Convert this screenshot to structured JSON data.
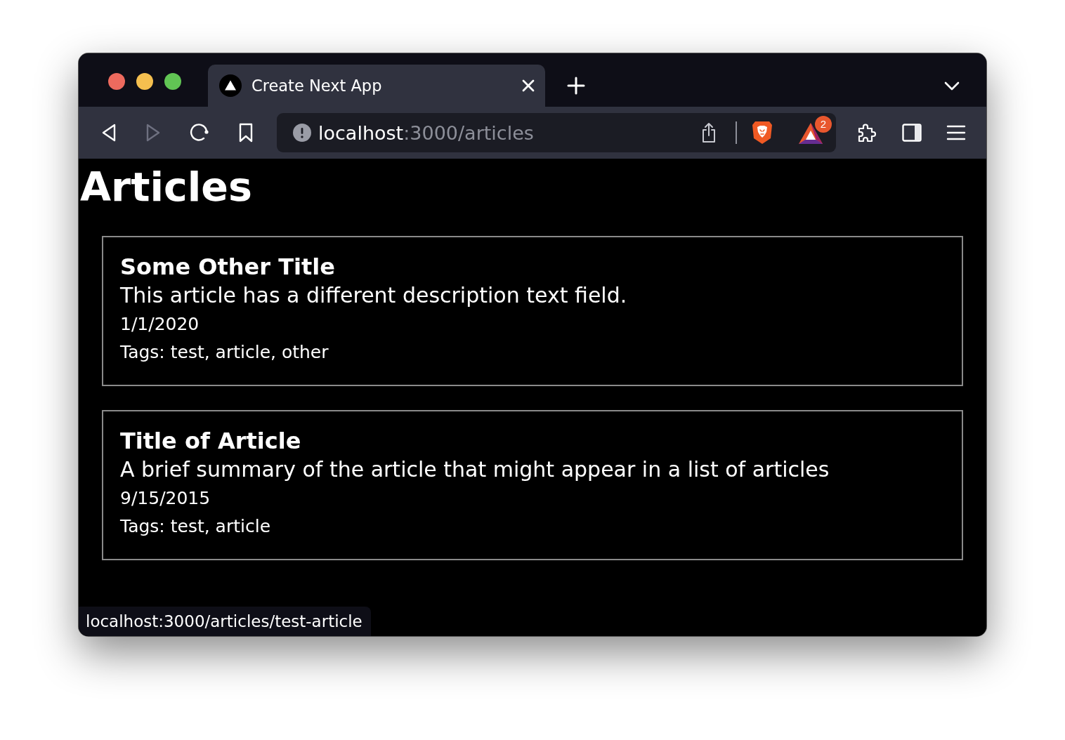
{
  "window": {
    "traffic_lights": [
      {
        "color": "#ed6a5e"
      },
      {
        "color": "#f5bf4f"
      },
      {
        "color": "#61c554"
      }
    ]
  },
  "tabs": [
    {
      "title": "Create Next App",
      "selected": true
    }
  ],
  "toolbar": {
    "nav_buttons": [
      {
        "kind": "back",
        "disabled": false
      },
      {
        "kind": "forward",
        "disabled": true
      },
      {
        "kind": "reload",
        "disabled": false
      },
      {
        "kind": "bookmark",
        "disabled": false
      }
    ],
    "address": {
      "host": "localhost",
      "rest": ":3000/articles"
    },
    "rewards_badge": "2"
  },
  "page": {
    "heading": "Articles",
    "articles": [
      {
        "title": "Some Other Title",
        "description": "This article has a different description text field.",
        "date": "1/1/2020",
        "tags": "Tags: test, article, other"
      },
      {
        "title": "Title of Article",
        "description": "A brief summary of the article that might appear in a list of articles",
        "date": "9/15/2015",
        "tags": "Tags: test, article"
      }
    ]
  },
  "status_bar": {
    "url": "localhost:3000/articles/test-article"
  }
}
